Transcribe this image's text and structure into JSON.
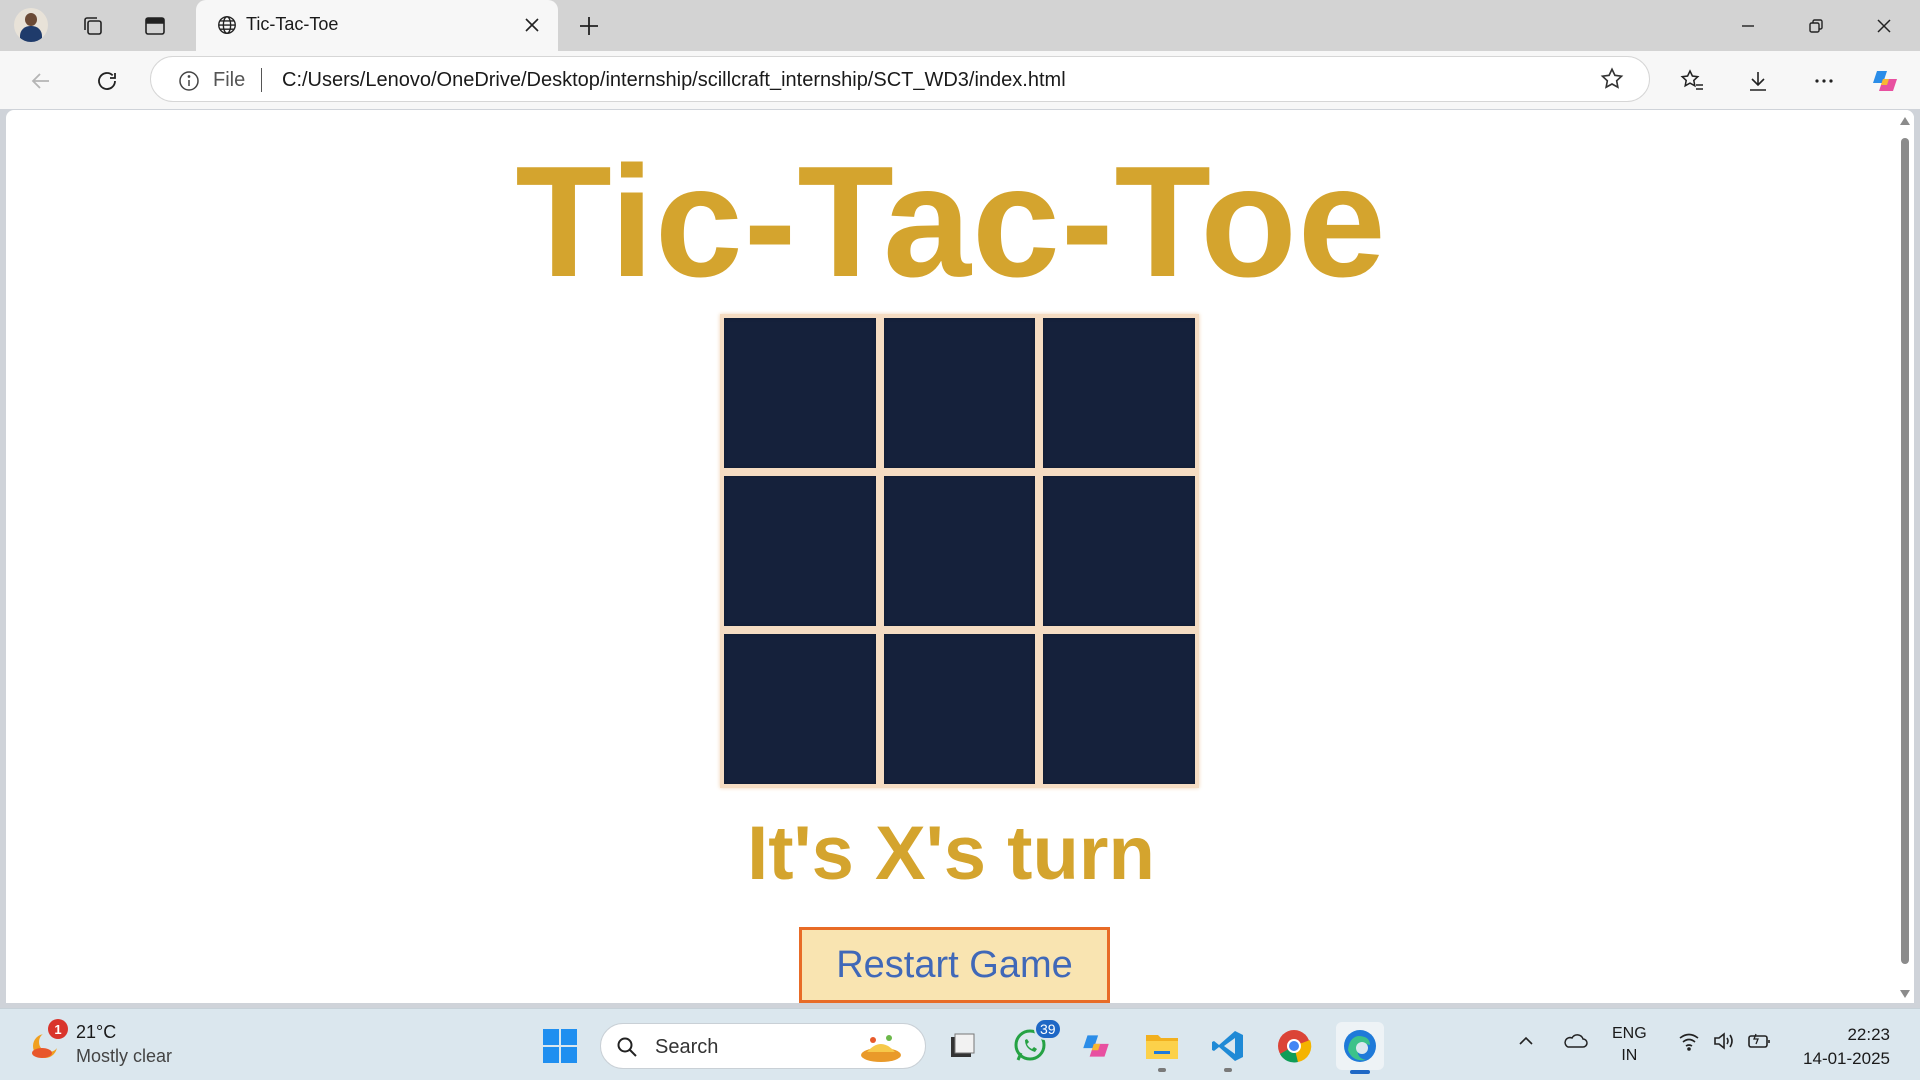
{
  "browser": {
    "tab": {
      "title": "Tic-Tac-Toe"
    },
    "address": {
      "scheme": "File",
      "url": "C:/Users/Lenovo/OneDrive/Desktop/internship/scillcraft_internship/SCT_WD3/index.html"
    }
  },
  "page": {
    "title": "Tic-Tac-Toe",
    "status": "It's X's turn",
    "restart_label": "Restart Game",
    "board": {
      "rows": 3,
      "cols": 3,
      "cells": [
        "",
        "",
        "",
        "",
        "",
        "",
        "",
        "",
        ""
      ]
    },
    "colors": {
      "title": "#d4a42e",
      "cell": "#15213b",
      "board_border": "#f5dcc2",
      "button_bg": "#f9e4b1",
      "button_border": "#e86b26",
      "button_text": "#4068b8"
    }
  },
  "taskbar": {
    "weather": {
      "temp": "21°C",
      "condition": "Mostly clear",
      "badge": "1"
    },
    "search_label": "Search",
    "whatsapp_badge": "39",
    "lang": {
      "line1": "ENG",
      "line2": "IN"
    },
    "clock": {
      "time": "22:23",
      "date": "14-01-2025"
    }
  }
}
